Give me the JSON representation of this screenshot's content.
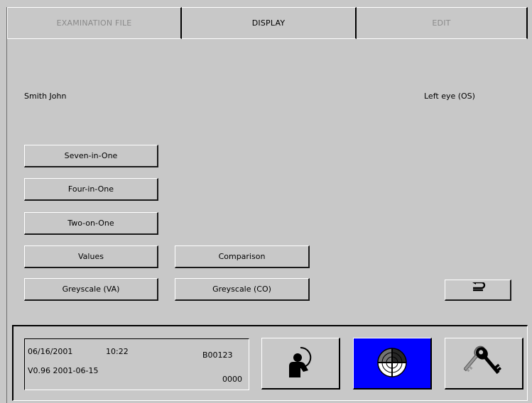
{
  "tabs": [
    {
      "label": "EXAMINATION FILE",
      "active": false
    },
    {
      "label": "DISPLAY",
      "active": true
    },
    {
      "label": "EDIT",
      "active": false
    }
  ],
  "patient_name": "Smith John",
  "eye": "Left eye (OS)",
  "buttons": {
    "seven_in_one": "Seven-in-One",
    "four_in_one": "Four-in-One",
    "two_on_one": "Two-on-One",
    "values": "Values",
    "comparison": "Comparison",
    "greyscale_va": "Greyscale (VA)",
    "greyscale_co": "Greyscale (CO)",
    "back_glyph": "⮌"
  },
  "info": {
    "date": "06/16/2001",
    "time": "10:22",
    "code": "B00123",
    "version": "V0.96  2001-06-15",
    "counter": "0000"
  },
  "icons": {
    "patient": "patient-icon",
    "perimeter": "perimeter-icon",
    "keys": "keys-icon"
  },
  "colors": {
    "background": "#c8c8c8",
    "active_tab_text": "#000000",
    "inactive_tab_text": "#8a8a8a",
    "selected_button": "#0000ff"
  }
}
